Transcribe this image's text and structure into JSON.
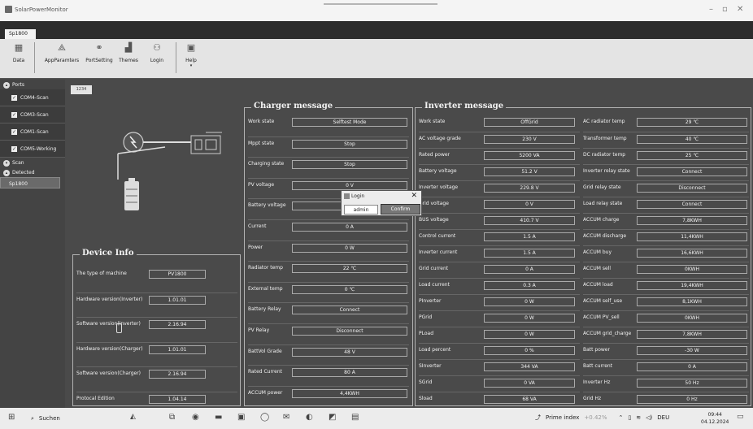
{
  "window": {
    "title": "SolarPowerMonitor"
  },
  "device_tab": "Sp1800",
  "ribbon": [
    {
      "label": "Data",
      "icon": "data-icon"
    },
    {
      "label": "AppParamters",
      "icon": "app-parameters-icon"
    },
    {
      "label": "PortSetting",
      "icon": "port-setting-icon"
    },
    {
      "label": "Themes",
      "icon": "themes-icon"
    },
    {
      "label": "Login",
      "icon": "login-icon"
    },
    {
      "label": "Help",
      "icon": "help-icon"
    }
  ],
  "sidebar": {
    "ports_label": "Ports",
    "ports": [
      "COM4-Scan",
      "COM3-Scan",
      "COM1-Scan",
      "COM5-Working"
    ],
    "scan_label": "Scan",
    "detected_label": "Detected",
    "detected_item": "Sp1800"
  },
  "inner_tab": "1234",
  "device_info": {
    "title": "Device Info",
    "rows": [
      {
        "label": "The type of machine",
        "value": "PV1800"
      },
      {
        "label": "Hardware version(Inverter)",
        "value": "1.01.01"
      },
      {
        "label": "Software version(Inverter)",
        "value": "2.16.94"
      },
      {
        "label": "Hardware version(Charger)",
        "value": "1.01.01"
      },
      {
        "label": "Software version(Charger)",
        "value": "2.16.94"
      },
      {
        "label": "Protocal Edition",
        "value": "1.04.14"
      }
    ]
  },
  "charger": {
    "title": "Charger message",
    "rows": [
      {
        "label": "Work state",
        "value": "Selftest Mode"
      },
      {
        "label": "Mppt state",
        "value": "Stop"
      },
      {
        "label": "Charging state",
        "value": "Stop"
      },
      {
        "label": "PV voltage",
        "value": "0 V"
      },
      {
        "label": "Battery voltage",
        "value": ""
      },
      {
        "label": "Current",
        "value": "0 A"
      },
      {
        "label": "Power",
        "value": "0 W"
      },
      {
        "label": "Radiator temp",
        "value": "22 ℃"
      },
      {
        "label": "External temp",
        "value": "0 ℃"
      },
      {
        "label": "Battery Relay",
        "value": "Connect"
      },
      {
        "label": "PV Relay",
        "value": "Disconnect"
      },
      {
        "label": "BattVol Grade",
        "value": "48 V"
      },
      {
        "label": "Rated Current",
        "value": "80 A"
      },
      {
        "label": "ACCUM power",
        "value": "4,4KWH"
      }
    ]
  },
  "inverter": {
    "title": "Inverter message",
    "left": [
      {
        "label": "Work state",
        "value": "OffGrid"
      },
      {
        "label": "AC voltage grade",
        "value": "230 V"
      },
      {
        "label": "Rated power",
        "value": "5200 VA"
      },
      {
        "label": "Battery voltage",
        "value": "51.2 V"
      },
      {
        "label": "Inverter voltage",
        "value": "229.8 V"
      },
      {
        "label": "Grid voltage",
        "value": "0 V"
      },
      {
        "label": "BUS voltage",
        "value": "410.7 V"
      },
      {
        "label": "Control current",
        "value": "1.5 A"
      },
      {
        "label": "Inverter current",
        "value": "1.5 A"
      },
      {
        "label": "Grid current",
        "value": "0 A"
      },
      {
        "label": "Load current",
        "value": "0.3 A"
      },
      {
        "label": "PInverter",
        "value": "0 W"
      },
      {
        "label": "PGrid",
        "value": "0 W"
      },
      {
        "label": "PLoad",
        "value": "0 W"
      },
      {
        "label": "Load percent",
        "value": "0 %"
      },
      {
        "label": "SInverter",
        "value": "344 VA"
      },
      {
        "label": "SGrid",
        "value": "0 VA"
      },
      {
        "label": "Sload",
        "value": "68 VA"
      }
    ],
    "right": [
      {
        "label": "AC radiator temp",
        "value": "29 ℃"
      },
      {
        "label": "Transformer temp",
        "value": "40 ℃"
      },
      {
        "label": "DC radiator temp",
        "value": "25 ℃"
      },
      {
        "label": "Inverter relay state",
        "value": "Connect"
      },
      {
        "label": "Grid relay state",
        "value": "Disconnect"
      },
      {
        "label": "Load relay state",
        "value": "Connect"
      },
      {
        "label": "ACCUM charge",
        "value": "7,8KWH"
      },
      {
        "label": "ACCUM discharge",
        "value": "11,4KWH"
      },
      {
        "label": "ACCUM buy",
        "value": "16,6KWH"
      },
      {
        "label": "ACCUM sell",
        "value": "0KWH"
      },
      {
        "label": "ACCUM load",
        "value": "19,4KWH"
      },
      {
        "label": "ACCUM self_use",
        "value": "8,1KWH"
      },
      {
        "label": "ACCUM PV_sell",
        "value": "0KWH"
      },
      {
        "label": "ACCUM grid_charge",
        "value": "7,8KWH"
      },
      {
        "label": "Batt power",
        "value": "-30 W"
      },
      {
        "label": "Batt current",
        "value": "0 A"
      },
      {
        "label": "Inverter Hz",
        "value": "50 Hz"
      },
      {
        "label": "Grid Hz",
        "value": "0 Hz"
      }
    ]
  },
  "login_dialog": {
    "title": "Login",
    "user": "admin",
    "confirm": "Confirm"
  },
  "taskbar": {
    "search": "Suchen",
    "stock_name": "Prime index",
    "stock_change": "+0.42%",
    "lang": "DEU",
    "time": "09:44",
    "date": "04.12.2024"
  }
}
